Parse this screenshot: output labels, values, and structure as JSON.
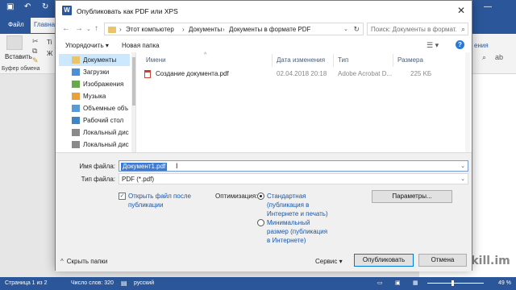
{
  "word": {
    "tabs": {
      "file": "Файл",
      "home": "Главна"
    },
    "ribbon": {
      "paste": "Вставить",
      "clipboard": "Буфер обмена",
      "right_fragment": "ения"
    },
    "status": {
      "page": "Страница 1 из 2",
      "words": "Число слов: 320",
      "language": "русский",
      "zoom": "49 %"
    },
    "watermark": "skill.im"
  },
  "dialog": {
    "title": "Опубликовать как PDF или XPS",
    "close": "✕",
    "breadcrumb": [
      "Этот компьютер",
      "Документы",
      "Документы в формате PDF"
    ],
    "search_placeholder": "Поиск: Документы в формат...",
    "toolbar": {
      "organize": "Упорядочить",
      "new_folder": "Новая папка",
      "help": "?"
    },
    "nav_items": [
      {
        "label": "Документы",
        "icon": "documents-folder-icon",
        "color": "#e9c46a",
        "selected": true
      },
      {
        "label": "Загрузки",
        "icon": "downloads-folder-icon",
        "color": "#4a90d9",
        "selected": false
      },
      {
        "label": "Изображения",
        "icon": "pictures-folder-icon",
        "color": "#6aa84f",
        "selected": false
      },
      {
        "label": "Музыка",
        "icon": "music-folder-icon",
        "color": "#e9a23b",
        "selected": false
      },
      {
        "label": "Объемные объ",
        "icon": "3d-objects-folder-icon",
        "color": "#5b9bd5",
        "selected": false
      },
      {
        "label": "Рабочий стол",
        "icon": "desktop-folder-icon",
        "color": "#3d85c6",
        "selected": false
      },
      {
        "label": "Локальный дис",
        "icon": "local-disk-icon",
        "color": "#8a8a8a",
        "selected": false
      },
      {
        "label": "Локальный дис",
        "icon": "local-disk-icon",
        "color": "#8a8a8a",
        "selected": false
      }
    ],
    "columns": {
      "name": "Имени",
      "modified": "Дата изменения",
      "type": "Тип",
      "size": "Размера"
    },
    "files": [
      {
        "name": "Создание документа.pdf",
        "modified": "02.04.2018 20:18",
        "type": "Adobe Acrobat D...",
        "size": "225 KБ"
      }
    ],
    "filename_label": "Имя файла:",
    "filename_value": "Документ1.pdf",
    "filetype_label": "Тип файла:",
    "filetype_value": "PDF (*.pdf)",
    "open_after_checked": true,
    "open_after_label_1": "Открыть файл после",
    "open_after_label_2": "публикации",
    "optimize_label": "Оптимизация:",
    "option_standard": {
      "selected": true,
      "line1": "Стандартная",
      "line2": "(публикация в",
      "line3": "Интернете и печать)"
    },
    "option_minimal": {
      "selected": false,
      "line1": "Минимальный",
      "line2": "размер (публикация",
      "line3": "в Интернете)"
    },
    "params_button": "Параметры...",
    "hide_folders": "Скрыть папки",
    "service": "Сервис",
    "publish_button": "Опубликовать",
    "cancel_button": "Отмена"
  }
}
